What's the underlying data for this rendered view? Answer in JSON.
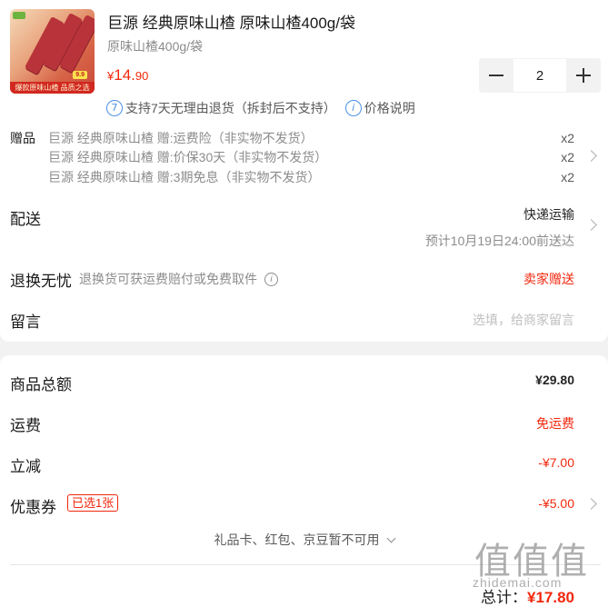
{
  "product": {
    "title": "巨源 经典原味山楂 原味山楂400g/袋",
    "spec": "原味山楂400g/袋",
    "price_currency": "¥",
    "price_int": "14.",
    "price_dec": "90",
    "thumb_banner": "爆款原味山楂 品质之选",
    "thumb_price": "9.9",
    "quantity": "2"
  },
  "services": {
    "return_icon": "7",
    "return_text": "支持7天无理由退货（拆封后不支持）",
    "info_icon": "i",
    "price_note": "价格说明"
  },
  "gifts": {
    "label": "赠品",
    "items": [
      {
        "name": "巨源 经典原味山楂 赠:运费险（非实物不发货）",
        "qty": "x2"
      },
      {
        "name": "巨源 经典原味山楂 赠:价保30天（非实物不发货）",
        "qty": "x2"
      },
      {
        "name": "巨源 经典原味山楂 赠:3期免息（非实物不发货）",
        "qty": "x2"
      }
    ]
  },
  "delivery": {
    "label": "配送",
    "method": "快递运输",
    "eta": "预计10月19日24:00前送达"
  },
  "returns": {
    "label": "退换无忧",
    "desc": "退换货可获运费赔付或免费取件",
    "info_icon": "i",
    "value": "卖家赠送"
  },
  "message": {
    "label": "留言",
    "placeholder": "选填，给商家留言"
  },
  "summary": {
    "goods_label": "商品总额",
    "goods_value": "¥29.80",
    "shipping_label": "运费",
    "shipping_value": "免运费",
    "discount_label": "立减",
    "discount_value": "-¥7.00",
    "coupon_label": "优惠券",
    "coupon_badge": "已选1张",
    "coupon_value": "-¥5.00",
    "unavailable": "礼品卡、红包、京豆暂不可用",
    "total_label": "总计：",
    "total_value": "¥17.80"
  },
  "watermark": {
    "logo": "值值值",
    "url": "zhidemai.com"
  },
  "colors": {
    "accent_red": "#f2270c",
    "info_blue": "#4a90e2",
    "background": "#f2f2f2"
  }
}
